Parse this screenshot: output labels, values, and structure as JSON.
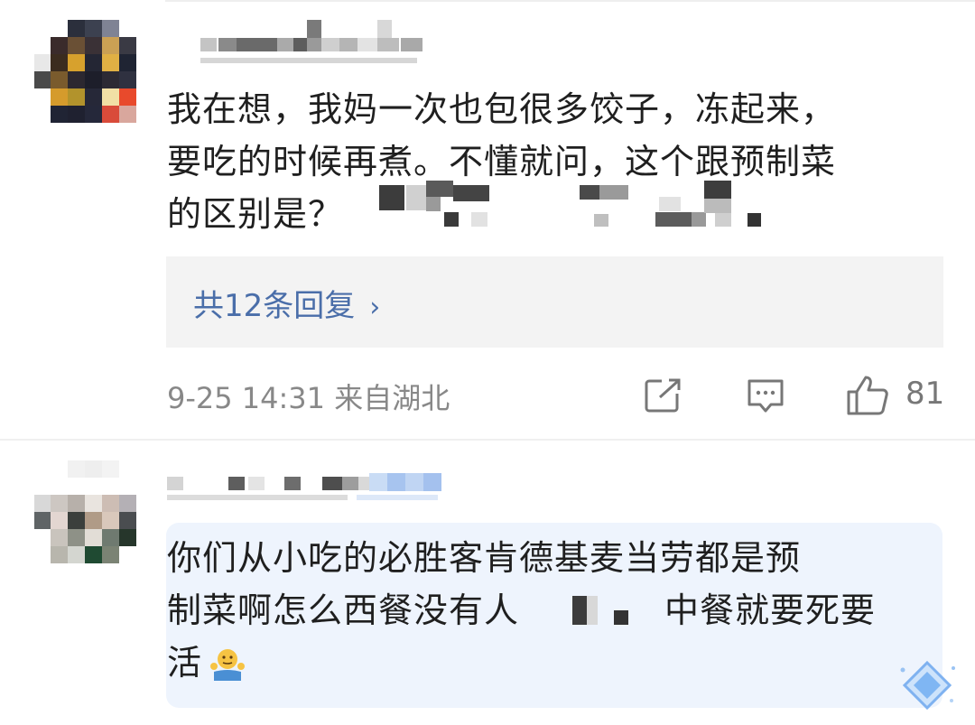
{
  "comments": [
    {
      "text_lines": [
        "我在想，我妈一次也包很多饺子，冻起来，",
        "要吃的时候再煮。不懂就问，这个跟预制菜",
        "的区别是？"
      ],
      "replies_link": "共12条回复",
      "meta": "9-25 14:31 来自湖北",
      "like_count": "81"
    },
    {
      "text_lines": [
        "你们从小吃的必胜客肯德基麦当劳都是预",
        "制菜啊怎么西餐没有人",
        "中餐就要死要",
        "活"
      ]
    }
  ],
  "colors": {
    "reply_link": "#4a6ea9",
    "reply_box_bg": "#f3f3f3",
    "highlight_bg": "#eef4fd",
    "meta_text": "#888888"
  },
  "icons": {
    "share": "share-icon",
    "comment": "comment-icon",
    "like": "thumbs-up-icon",
    "chevron": "chevron-right-icon",
    "emoji": "shrug-emoji-icon",
    "badge": "diamond-badge-icon"
  }
}
